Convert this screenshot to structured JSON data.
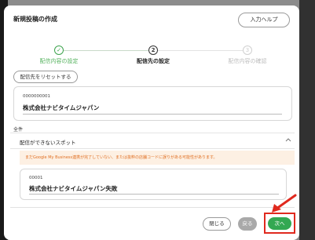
{
  "modal": {
    "title": "新規投稿の作成",
    "help_label": "入力ヘルプ"
  },
  "stepper": {
    "steps": [
      {
        "number": "✓",
        "label": "配信内容の設定",
        "state": "done"
      },
      {
        "number": "2",
        "label": "配信先の設定",
        "state": "active"
      },
      {
        "number": "3",
        "label": "配信内容の確認",
        "state": "future"
      }
    ]
  },
  "reset_label": "配信先をリセットする",
  "selected_card": {
    "code": "0000000001",
    "name": "株式会社ナビタイムジャパン"
  },
  "all_label": "全件",
  "unavailable": {
    "label": "配信ができないスポット"
  },
  "warning_text": "まだGoogle My Business連携が完了していない、または抜粋の店舗コードに誤りがある可能性があります。",
  "failed_card": {
    "code": "00001",
    "name": "株式会社ナビタイムジャパン失敗"
  },
  "footer": {
    "close_label": "閉じる",
    "back_label": "戻る",
    "next_label": "次へ"
  },
  "colors": {
    "accent_green": "#33a852",
    "highlight_red": "#e0291e",
    "warning_text": "#e06f22",
    "warning_bg": "#fdf0e3"
  }
}
